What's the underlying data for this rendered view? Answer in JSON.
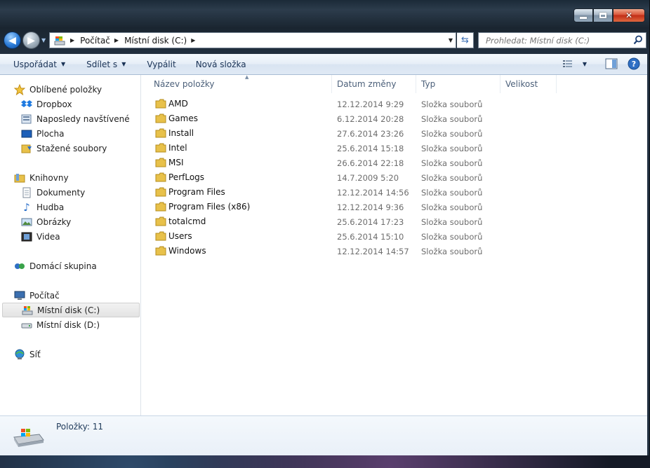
{
  "window": {
    "controls": {
      "minimize": "minimize",
      "maximize": "maximize",
      "close": "close"
    }
  },
  "address": {
    "crumbs": [
      "Počítač",
      "Místní disk (C:)"
    ]
  },
  "search": {
    "placeholder": "Prohledat: Místní disk (C:)"
  },
  "toolbar": {
    "organize": "Uspořádat",
    "share": "Sdílet s",
    "burn": "Vypálit",
    "new_folder": "Nová složka"
  },
  "sidebar": {
    "favorites": {
      "label": "Oblíbené položky",
      "items": [
        "Dropbox",
        "Naposledy navštívené",
        "Plocha",
        "Stažené soubory"
      ]
    },
    "libraries": {
      "label": "Knihovny",
      "items": [
        "Dokumenty",
        "Hudba",
        "Obrázky",
        "Videa"
      ]
    },
    "homegroup": {
      "label": "Domácí skupina"
    },
    "computer": {
      "label": "Počítač",
      "items": [
        "Místní disk (C:)",
        "Místní disk (D:)"
      ]
    },
    "network": {
      "label": "Síť"
    }
  },
  "columns": [
    "Název položky",
    "Datum změny",
    "Typ",
    "Velikost"
  ],
  "files": [
    {
      "name": "AMD",
      "date": "12.12.2014 9:29",
      "type": "Složka souborů"
    },
    {
      "name": "Games",
      "date": "6.12.2014 20:28",
      "type": "Složka souborů"
    },
    {
      "name": "Install",
      "date": "27.6.2014 23:26",
      "type": "Složka souborů"
    },
    {
      "name": "Intel",
      "date": "25.6.2014 15:18",
      "type": "Složka souborů"
    },
    {
      "name": "MSI",
      "date": "26.6.2014 22:18",
      "type": "Složka souborů"
    },
    {
      "name": "PerfLogs",
      "date": "14.7.2009 5:20",
      "type": "Složka souborů"
    },
    {
      "name": "Program Files",
      "date": "12.12.2014 14:56",
      "type": "Složka souborů"
    },
    {
      "name": "Program Files (x86)",
      "date": "12.12.2014 9:36",
      "type": "Složka souborů"
    },
    {
      "name": "totalcmd",
      "date": "25.6.2014 17:23",
      "type": "Složka souborů"
    },
    {
      "name": "Users",
      "date": "25.6.2014 15:10",
      "type": "Složka souborů"
    },
    {
      "name": "Windows",
      "date": "12.12.2014 14:57",
      "type": "Složka souborů"
    }
  ],
  "details": {
    "item_count": "Položky: 11"
  },
  "colors": {
    "accent": "#1a3356",
    "folder": "#e8c14a",
    "selection": "#e3e3e3"
  }
}
